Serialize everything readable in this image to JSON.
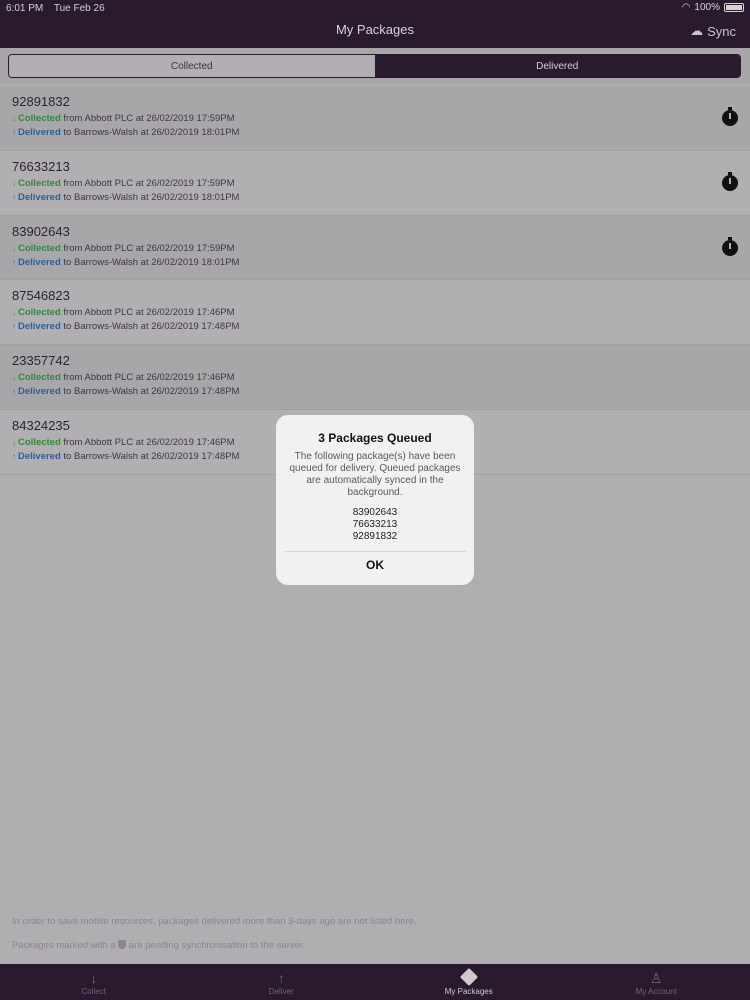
{
  "status": {
    "time": "6:01 PM",
    "date": "Tue Feb 26",
    "battery": "100%"
  },
  "nav": {
    "title": "My Packages",
    "sync_label": "Sync"
  },
  "segments": [
    {
      "label": "Collected",
      "active": false
    },
    {
      "label": "Delivered",
      "active": true
    }
  ],
  "packages": [
    {
      "id": "92891832",
      "collected_word": "Collected",
      "collected_rest": " from Abbott PLC at 26/02/2019 17:59PM",
      "delivered_word": "Delivered",
      "delivered_rest": " to Barrows-Walsh at 26/02/2019 18:01PM",
      "queued": true
    },
    {
      "id": "76633213",
      "collected_word": "Collected",
      "collected_rest": " from Abbott PLC at 26/02/2019 17:59PM",
      "delivered_word": "Delivered",
      "delivered_rest": " to Barrows-Walsh at 26/02/2019 18:01PM",
      "queued": true
    },
    {
      "id": "83902643",
      "collected_word": "Collected",
      "collected_rest": " from Abbott PLC at 26/02/2019 17:59PM",
      "delivered_word": "Delivered",
      "delivered_rest": " to Barrows-Walsh at 26/02/2019 18:01PM",
      "queued": true
    },
    {
      "id": "87546823",
      "collected_word": "Collected",
      "collected_rest": " from Abbott PLC at 26/02/2019 17:46PM",
      "delivered_word": "Delivered",
      "delivered_rest": " to Barrows-Walsh at 26/02/2019 17:48PM",
      "queued": false
    },
    {
      "id": "23357742",
      "collected_word": "Collected",
      "collected_rest": " from Abbott PLC at 26/02/2019 17:46PM",
      "delivered_word": "Delivered",
      "delivered_rest": " to Barrows-Walsh at 26/02/2019 17:48PM",
      "queued": false
    },
    {
      "id": "84324235",
      "collected_word": "Collected",
      "collected_rest": " from Abbott PLC at 26/02/2019 17:46PM",
      "delivered_word": "Delivered",
      "delivered_rest": " to Barrows-Walsh at 26/02/2019 17:48PM",
      "queued": false
    }
  ],
  "footer": {
    "note1": "In order to save mobile resources, packages delivered more than 3-days ago are not listed here.",
    "note2_before": "Packages marked with a ",
    "note2_after": " are pending synchronisation to the server."
  },
  "tabs": [
    {
      "label": "Collect",
      "icon": "↓",
      "active": false
    },
    {
      "label": "Deliver",
      "icon": "↑",
      "active": false
    },
    {
      "label": "My Packages",
      "icon": "box",
      "active": true
    },
    {
      "label": "My Account",
      "icon": "person",
      "active": false
    }
  ],
  "modal": {
    "title": "3 Packages Queued",
    "message": "The following package(s) have been queued for delivery. Queued packages are automatically synced in the background.",
    "items": [
      "83902643",
      "76633213",
      "92891832"
    ],
    "ok_label": "OK"
  },
  "colors": {
    "bar": "#2a1a2f",
    "collected": "#2f8a3b",
    "delivered": "#2e5f93"
  }
}
